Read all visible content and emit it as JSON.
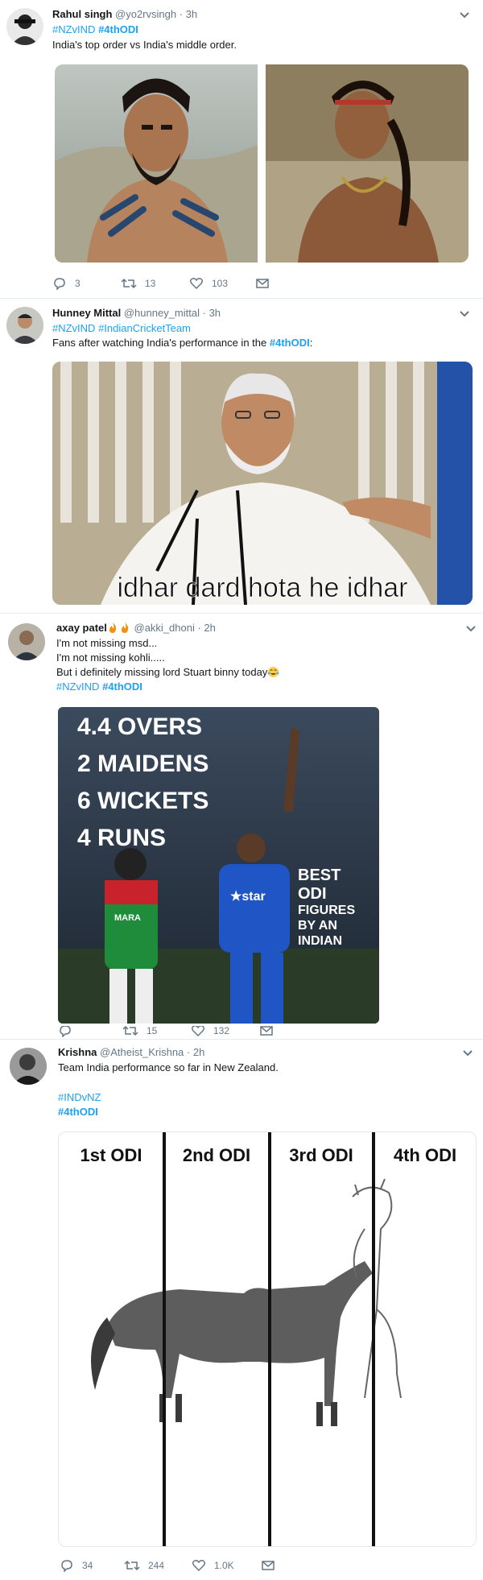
{
  "tweets": [
    {
      "name": "Rahul singh",
      "handle": "@yo2rvsingh",
      "time": "· 3h",
      "hashtags": [
        "#NZvIND",
        "#4thODI"
      ],
      "lines": [
        "India's top order vs India's middle order."
      ],
      "replies": "3",
      "retweets": "13",
      "likes": "103"
    },
    {
      "name": "Hunney Mittal",
      "handle": "@hunney_mittal",
      "time": "· 3h",
      "hashtags": [
        "#NZvIND",
        "#IndianCricketTeam"
      ],
      "lines": [
        "Fans after watching India's performance in the"
      ],
      "inline_tag": "#4thODI",
      "inline_suffix": ":",
      "image_caption": "idhar dard hota he idhar"
    },
    {
      "name": "axay patel",
      "handle": "@akki_dhoni",
      "time": "· 2h",
      "lines": [
        "I'm not missing msd...",
        "I'm not missing kohli.....",
        "But i definitely missing lord Stuart binny today"
      ],
      "hashtags": [
        "#NZvIND",
        "#4thODI"
      ],
      "image_text": [
        "4.4 OVERS",
        "2 MAIDENS",
        "6 WICKETS",
        "4 RUNS"
      ],
      "image_side": [
        "BEST",
        "ODI",
        "FIGURES",
        "BY AN",
        "INDIAN"
      ],
      "jersey_logo": "★star",
      "replies": "",
      "retweets": "15",
      "likes": "132"
    },
    {
      "name": "Krishna",
      "handle": "@Atheist_Krishna",
      "time": "· 2h",
      "lines": [
        "Team India performance so far in New Zealand."
      ],
      "hashtags": [
        "#INDvNZ",
        "#4thODI"
      ],
      "panels": [
        "1st ODI",
        "2nd ODI",
        "3rd ODI",
        "4th ODI"
      ],
      "replies": "34",
      "retweets": "244",
      "likes": "1.0K"
    }
  ]
}
